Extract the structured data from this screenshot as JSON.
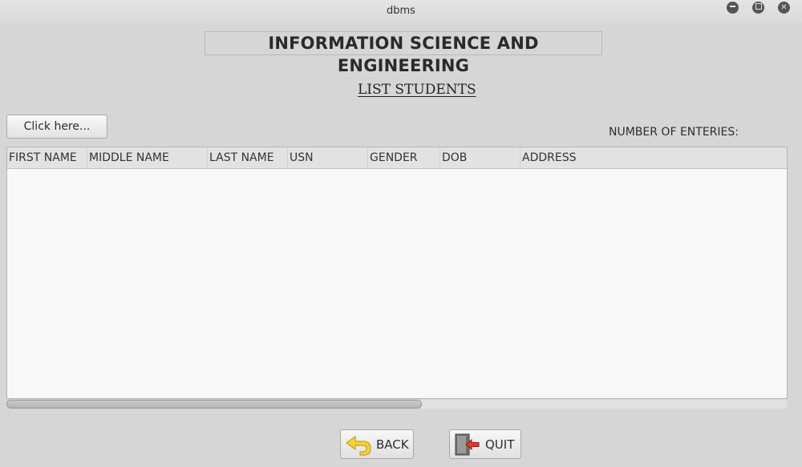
{
  "window": {
    "title": "dbms",
    "controls": [
      "minimize",
      "maximize",
      "close"
    ]
  },
  "header": {
    "title": "INFORMATION SCIENCE AND ENGINEERING",
    "subtitle": "LIST STUDENTS"
  },
  "toolbar": {
    "click_label": "Click here...",
    "entries_label": "NUMBER OF ENTERIES:",
    "entries_value": ""
  },
  "table": {
    "columns": [
      "FIRST NAME",
      "MIDDLE NAME",
      "LAST NAME",
      "USN",
      "GENDER",
      "DOB",
      "ADDRESS"
    ],
    "rows": []
  },
  "footer": {
    "back_label": "BACK",
    "back_icon": "back-arrow-icon",
    "quit_label": "QUIT",
    "quit_icon": "exit-door-icon"
  }
}
